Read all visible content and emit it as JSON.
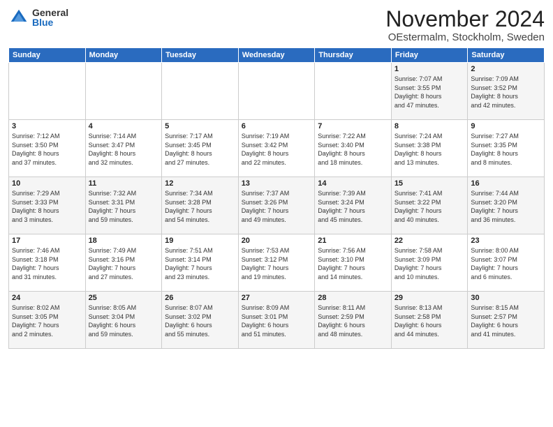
{
  "logo": {
    "general": "General",
    "blue": "Blue"
  },
  "header": {
    "month": "November 2024",
    "location": "OEstermalm, Stockholm, Sweden"
  },
  "weekdays": [
    "Sunday",
    "Monday",
    "Tuesday",
    "Wednesday",
    "Thursday",
    "Friday",
    "Saturday"
  ],
  "weeks": [
    [
      {
        "day": "",
        "info": ""
      },
      {
        "day": "",
        "info": ""
      },
      {
        "day": "",
        "info": ""
      },
      {
        "day": "",
        "info": ""
      },
      {
        "day": "",
        "info": ""
      },
      {
        "day": "1",
        "info": "Sunrise: 7:07 AM\nSunset: 3:55 PM\nDaylight: 8 hours\nand 47 minutes."
      },
      {
        "day": "2",
        "info": "Sunrise: 7:09 AM\nSunset: 3:52 PM\nDaylight: 8 hours\nand 42 minutes."
      }
    ],
    [
      {
        "day": "3",
        "info": "Sunrise: 7:12 AM\nSunset: 3:50 PM\nDaylight: 8 hours\nand 37 minutes."
      },
      {
        "day": "4",
        "info": "Sunrise: 7:14 AM\nSunset: 3:47 PM\nDaylight: 8 hours\nand 32 minutes."
      },
      {
        "day": "5",
        "info": "Sunrise: 7:17 AM\nSunset: 3:45 PM\nDaylight: 8 hours\nand 27 minutes."
      },
      {
        "day": "6",
        "info": "Sunrise: 7:19 AM\nSunset: 3:42 PM\nDaylight: 8 hours\nand 22 minutes."
      },
      {
        "day": "7",
        "info": "Sunrise: 7:22 AM\nSunset: 3:40 PM\nDaylight: 8 hours\nand 18 minutes."
      },
      {
        "day": "8",
        "info": "Sunrise: 7:24 AM\nSunset: 3:38 PM\nDaylight: 8 hours\nand 13 minutes."
      },
      {
        "day": "9",
        "info": "Sunrise: 7:27 AM\nSunset: 3:35 PM\nDaylight: 8 hours\nand 8 minutes."
      }
    ],
    [
      {
        "day": "10",
        "info": "Sunrise: 7:29 AM\nSunset: 3:33 PM\nDaylight: 8 hours\nand 3 minutes."
      },
      {
        "day": "11",
        "info": "Sunrise: 7:32 AM\nSunset: 3:31 PM\nDaylight: 7 hours\nand 59 minutes."
      },
      {
        "day": "12",
        "info": "Sunrise: 7:34 AM\nSunset: 3:28 PM\nDaylight: 7 hours\nand 54 minutes."
      },
      {
        "day": "13",
        "info": "Sunrise: 7:37 AM\nSunset: 3:26 PM\nDaylight: 7 hours\nand 49 minutes."
      },
      {
        "day": "14",
        "info": "Sunrise: 7:39 AM\nSunset: 3:24 PM\nDaylight: 7 hours\nand 45 minutes."
      },
      {
        "day": "15",
        "info": "Sunrise: 7:41 AM\nSunset: 3:22 PM\nDaylight: 7 hours\nand 40 minutes."
      },
      {
        "day": "16",
        "info": "Sunrise: 7:44 AM\nSunset: 3:20 PM\nDaylight: 7 hours\nand 36 minutes."
      }
    ],
    [
      {
        "day": "17",
        "info": "Sunrise: 7:46 AM\nSunset: 3:18 PM\nDaylight: 7 hours\nand 31 minutes."
      },
      {
        "day": "18",
        "info": "Sunrise: 7:49 AM\nSunset: 3:16 PM\nDaylight: 7 hours\nand 27 minutes."
      },
      {
        "day": "19",
        "info": "Sunrise: 7:51 AM\nSunset: 3:14 PM\nDaylight: 7 hours\nand 23 minutes."
      },
      {
        "day": "20",
        "info": "Sunrise: 7:53 AM\nSunset: 3:12 PM\nDaylight: 7 hours\nand 19 minutes."
      },
      {
        "day": "21",
        "info": "Sunrise: 7:56 AM\nSunset: 3:10 PM\nDaylight: 7 hours\nand 14 minutes."
      },
      {
        "day": "22",
        "info": "Sunrise: 7:58 AM\nSunset: 3:09 PM\nDaylight: 7 hours\nand 10 minutes."
      },
      {
        "day": "23",
        "info": "Sunrise: 8:00 AM\nSunset: 3:07 PM\nDaylight: 7 hours\nand 6 minutes."
      }
    ],
    [
      {
        "day": "24",
        "info": "Sunrise: 8:02 AM\nSunset: 3:05 PM\nDaylight: 7 hours\nand 2 minutes."
      },
      {
        "day": "25",
        "info": "Sunrise: 8:05 AM\nSunset: 3:04 PM\nDaylight: 6 hours\nand 59 minutes."
      },
      {
        "day": "26",
        "info": "Sunrise: 8:07 AM\nSunset: 3:02 PM\nDaylight: 6 hours\nand 55 minutes."
      },
      {
        "day": "27",
        "info": "Sunrise: 8:09 AM\nSunset: 3:01 PM\nDaylight: 6 hours\nand 51 minutes."
      },
      {
        "day": "28",
        "info": "Sunrise: 8:11 AM\nSunset: 2:59 PM\nDaylight: 6 hours\nand 48 minutes."
      },
      {
        "day": "29",
        "info": "Sunrise: 8:13 AM\nSunset: 2:58 PM\nDaylight: 6 hours\nand 44 minutes."
      },
      {
        "day": "30",
        "info": "Sunrise: 8:15 AM\nSunset: 2:57 PM\nDaylight: 6 hours\nand 41 minutes."
      }
    ]
  ]
}
